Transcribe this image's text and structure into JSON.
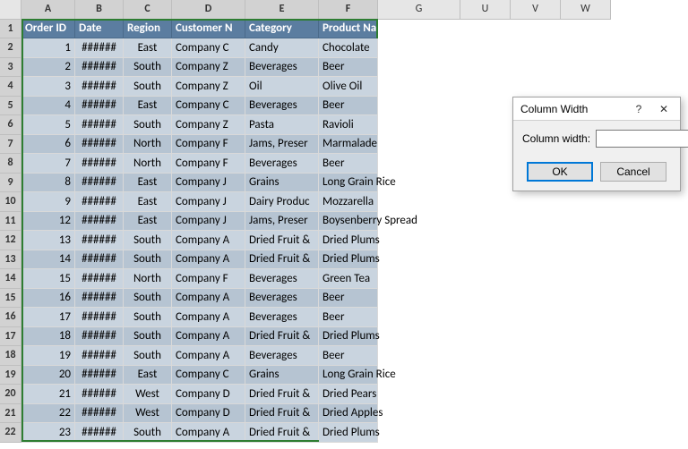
{
  "columns": [
    {
      "letter": "A",
      "sel": true
    },
    {
      "letter": "B",
      "sel": true
    },
    {
      "letter": "C",
      "sel": true
    },
    {
      "letter": "D",
      "sel": true
    },
    {
      "letter": "E",
      "sel": true
    },
    {
      "letter": "F",
      "sel": true
    },
    {
      "letter": "G",
      "sel": false
    },
    {
      "letter": "U",
      "sel": false
    },
    {
      "letter": "V",
      "sel": false
    },
    {
      "letter": "W",
      "sel": false
    }
  ],
  "header_row": [
    "Order ID",
    "Date",
    "Region",
    "Customer N",
    "Category",
    "Product Na"
  ],
  "rows": [
    {
      "n": 1,
      "id": "1",
      "date": "######",
      "region": "East",
      "cust": "Company C",
      "cat": "Candy",
      "prod": "Chocolate"
    },
    {
      "n": 2,
      "id": "2",
      "date": "######",
      "region": "South",
      "cust": "Company Z",
      "cat": "Beverages",
      "prod": "Beer"
    },
    {
      "n": 3,
      "id": "3",
      "date": "######",
      "region": "South",
      "cust": "Company Z",
      "cat": "Oil",
      "prod": "Olive Oil"
    },
    {
      "n": 4,
      "id": "4",
      "date": "######",
      "region": "East",
      "cust": "Company C",
      "cat": "Beverages",
      "prod": "Beer"
    },
    {
      "n": 5,
      "id": "5",
      "date": "######",
      "region": "South",
      "cust": "Company Z",
      "cat": "Pasta",
      "prod": "Ravioli"
    },
    {
      "n": 6,
      "id": "6",
      "date": "######",
      "region": "North",
      "cust": "Company F",
      "cat": "Jams, Preser",
      "prod": "Marmalade"
    },
    {
      "n": 7,
      "id": "7",
      "date": "######",
      "region": "North",
      "cust": "Company F",
      "cat": "Beverages",
      "prod": "Beer"
    },
    {
      "n": 8,
      "id": "8",
      "date": "######",
      "region": "East",
      "cust": "Company J",
      "cat": "Grains",
      "prod": "Long Grain Rice"
    },
    {
      "n": 9,
      "id": "9",
      "date": "######",
      "region": "East",
      "cust": "Company J",
      "cat": "Dairy Produc",
      "prod": "Mozzarella"
    },
    {
      "n": 10,
      "id": "12",
      "date": "######",
      "region": "East",
      "cust": "Company J",
      "cat": "Jams, Preser",
      "prod": "Boysenberry Spread"
    },
    {
      "n": 11,
      "id": "13",
      "date": "######",
      "region": "South",
      "cust": "Company A",
      "cat": "Dried Fruit &",
      "prod": "Dried Plums"
    },
    {
      "n": 12,
      "id": "14",
      "date": "######",
      "region": "South",
      "cust": "Company A",
      "cat": "Dried Fruit &",
      "prod": "Dried Plums"
    },
    {
      "n": 13,
      "id": "15",
      "date": "######",
      "region": "North",
      "cust": "Company F",
      "cat": "Beverages",
      "prod": "Green Tea"
    },
    {
      "n": 14,
      "id": "16",
      "date": "######",
      "region": "South",
      "cust": "Company A",
      "cat": "Beverages",
      "prod": "Beer"
    },
    {
      "n": 15,
      "id": "17",
      "date": "######",
      "region": "South",
      "cust": "Company A",
      "cat": "Beverages",
      "prod": "Beer"
    },
    {
      "n": 16,
      "id": "18",
      "date": "######",
      "region": "South",
      "cust": "Company A",
      "cat": "Dried Fruit &",
      "prod": "Dried Plums"
    },
    {
      "n": 17,
      "id": "19",
      "date": "######",
      "region": "South",
      "cust": "Company A",
      "cat": "Beverages",
      "prod": "Beer"
    },
    {
      "n": 18,
      "id": "20",
      "date": "######",
      "region": "East",
      "cust": "Company C",
      "cat": "Grains",
      "prod": "Long Grain Rice"
    },
    {
      "n": 19,
      "id": "21",
      "date": "######",
      "region": "West",
      "cust": "Company D",
      "cat": "Dried Fruit &",
      "prod": "Dried Pears"
    },
    {
      "n": 20,
      "id": "22",
      "date": "######",
      "region": "West",
      "cust": "Company D",
      "cat": "Dried Fruit &",
      "prod": "Dried Apples"
    },
    {
      "n": 21,
      "id": "23",
      "date": "######",
      "region": "South",
      "cust": "Company A",
      "cat": "Dried Fruit &",
      "prod": "Dried Plums"
    }
  ],
  "dialog": {
    "title": "Column Width",
    "label": "Column width:",
    "value": "",
    "ok": "OK",
    "cancel": "Cancel"
  }
}
